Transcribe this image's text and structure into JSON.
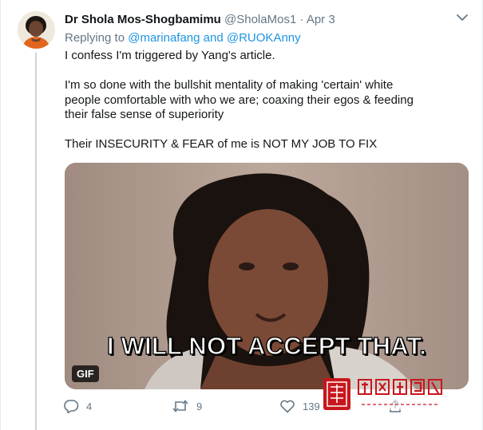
{
  "tweet": {
    "author_name": "Dr Shola Mos-Shogbamimu",
    "handle": "@SholaMos1",
    "separator": "·",
    "date": "Apr 3",
    "replying_prefix": "Replying to",
    "replying_user_1": "@marinafang",
    "replying_and": "and",
    "replying_user_2": "@RUOKAnny",
    "body_lines": [
      "I confess I'm triggered by Yang's article.",
      "I'm so done with the bullshit mentality of making 'certain' white",
      "people comfortable with who we are; coaxing their egos & feeding",
      "their false sense of superiority",
      "Their INSECURITY & FEAR of me is NOT MY JOB TO FIX"
    ],
    "media": {
      "caption": "I WILL NOT ACCEPT THAT.",
      "badge": "GIF"
    },
    "actions": {
      "reply_count": "4",
      "retweet_count": "9",
      "like_count": "139"
    }
  },
  "icons": [
    "chevron-down-icon",
    "reply-icon",
    "retweet-icon",
    "like-icon",
    "share-icon"
  ],
  "colors": {
    "link": "#1b95e0",
    "secondary_text": "#657786",
    "thread_line": "#ccd6dd",
    "watermark_red": "#c8161d"
  },
  "watermark": {
    "title": "强国之路网",
    "url": "www.强国之路.cn"
  }
}
